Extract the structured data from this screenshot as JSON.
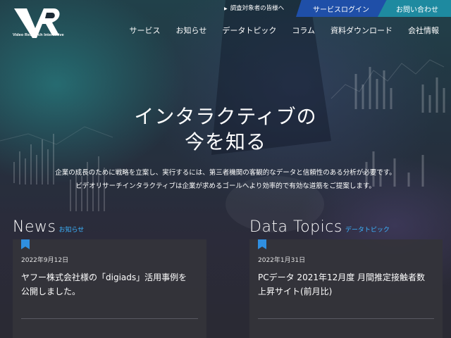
{
  "header": {
    "logo_text": "Video Research Interactive",
    "topbar_link": "調査対象者の皆様へ",
    "login_button": "サービスログイン",
    "contact_button": "お問い合わせ",
    "nav": [
      "サービス",
      "お知らせ",
      "データトピック",
      "コラム",
      "資料ダウンロード",
      "会社情報"
    ]
  },
  "hero": {
    "title_line1": "インタラクティブの",
    "title_line2": "今を知る",
    "desc_line1": "企業の成長のために戦略を立案し、実行するには、第三者機関の客観的なデータと信頼性のある分析が必要です。",
    "desc_line2": "ビデオリサーチインタラクティブは企業が求めるゴールへより効率的で有効な道筋をご提案します。"
  },
  "news": {
    "heading": "News",
    "subheading": "お知らせ",
    "date": "2022年9月12日",
    "headline": "ヤフー株式会社様の「digiads」活用事例を公開しました。"
  },
  "topics": {
    "heading": "Data Topics",
    "subheading": "データトピック",
    "date": "2022年1月31日",
    "headline": "PCデータ 2021年12月度 月間推定接触者数上昇サイト(前月比)"
  },
  "colors": {
    "login_bg": "#1f4fa8",
    "contact_bg": "#1e8aa0",
    "accent_blue": "#3cb4ff",
    "card_bg": "#34343a"
  }
}
